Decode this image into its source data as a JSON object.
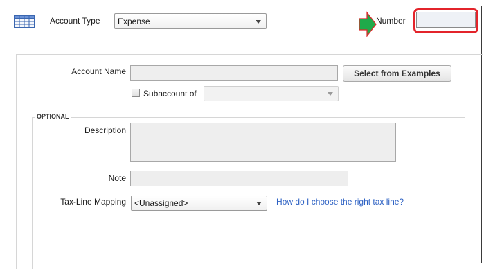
{
  "header": {
    "account_type_label": "Account Type",
    "account_type_value": "Expense",
    "number_label": "Number",
    "number_value": ""
  },
  "account_name": {
    "label": "Account Name",
    "value": "",
    "select_examples_button": "Select from Examples"
  },
  "subaccount": {
    "label": "Subaccount of",
    "checked": false,
    "value": ""
  },
  "optional": {
    "section_label": "OPTIONAL",
    "description_label": "Description",
    "description_value": "",
    "note_label": "Note",
    "note_value": "",
    "tax_line_label": "Tax-Line Mapping",
    "tax_line_value": "<Unassigned>",
    "tax_help_link": "How do I choose the right tax line?"
  },
  "icons": {
    "account": "table-grid-icon",
    "pointer": "green-arrow-icon",
    "highlight": "red-highlight-ring"
  },
  "colors": {
    "highlight": "#e3242b",
    "pointer_arrow": "#1faa4a",
    "link": "#2e62c4"
  }
}
